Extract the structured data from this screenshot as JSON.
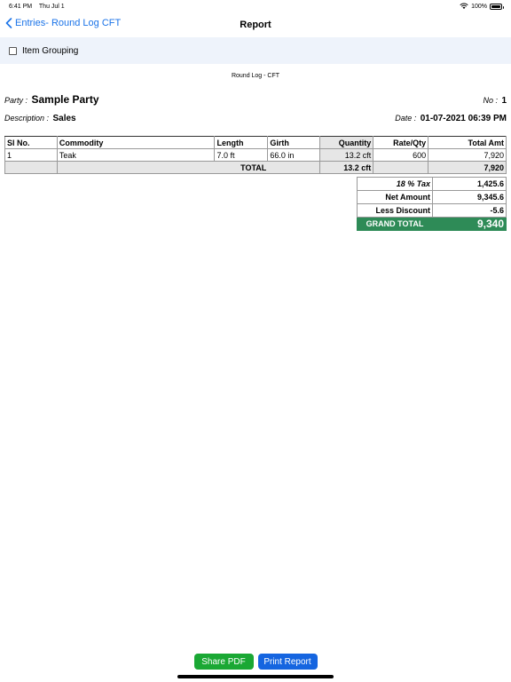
{
  "status_bar": {
    "time": "6:41 PM",
    "date": "Thu Jul 1",
    "battery": "100%"
  },
  "nav": {
    "back_label": "Entries- Round Log CFT",
    "title": "Report"
  },
  "toolbar": {
    "item_grouping_label": "Item Grouping",
    "item_grouping_checked": false
  },
  "report": {
    "title": "Round Log - CFT",
    "party_label": "Party :",
    "party_value": "Sample Party",
    "no_label": "No :",
    "no_value": "1",
    "description_label": "Description :",
    "description_value": "Sales",
    "date_label": "Date :",
    "date_value": "01-07-2021 06:39 PM"
  },
  "table": {
    "headers": [
      "Sl No.",
      "Commodity",
      "Length",
      "Girth",
      "Quantity",
      "Rate/Qty",
      "Total Amt"
    ],
    "rows": [
      [
        "1",
        "Teak",
        "7.0 ft",
        "66.0 in",
        "13.2 cft",
        "600",
        "7,920"
      ]
    ],
    "total": {
      "label": "TOTAL",
      "quantity": "13.2 cft",
      "amount": "7,920"
    }
  },
  "summary": {
    "tax_label": "18 % Tax",
    "tax_value": "1,425.6",
    "net_label": "Net Amount",
    "net_value": "9,345.6",
    "discount_label": "Less Discount",
    "discount_value": "-5.6",
    "grand_label": "GRAND TOTAL",
    "grand_value": "9,340"
  },
  "buttons": {
    "share_label": "Share PDF",
    "print_label": "Print Report"
  },
  "colors": {
    "accent_blue": "#1a73e8",
    "grand_total_green": "#2e8b57",
    "share_green": "#1aa834",
    "print_blue": "#1565e0"
  }
}
